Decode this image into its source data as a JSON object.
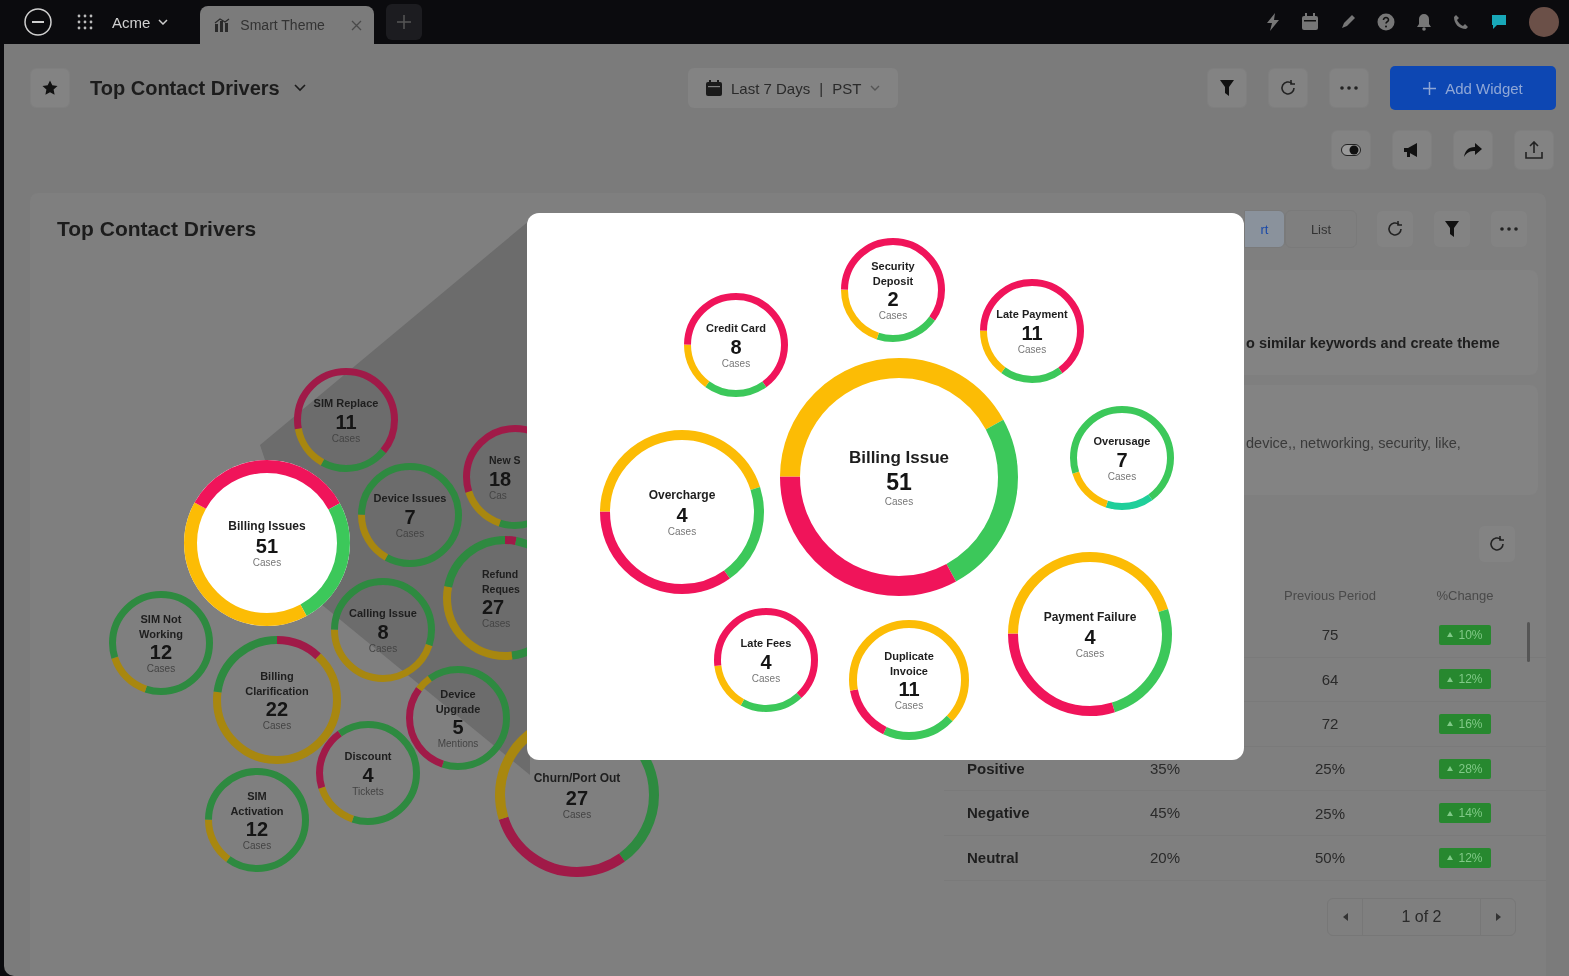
{
  "topbar": {
    "workspace": "Acme",
    "tabs": [
      {
        "label": "Smart Theme",
        "selected": true
      }
    ]
  },
  "header": {
    "title": "Top Contact Drivers",
    "date_range": "Last 7 Days",
    "separator": "|",
    "timezone": "PST",
    "add_button": "Add Widget"
  },
  "widget": {
    "title": "Top Contact Drivers",
    "view_tabs": [
      {
        "label": "rt",
        "selected": true
      },
      {
        "label": "List",
        "selected": false
      }
    ],
    "bubbles": [
      {
        "label": "SIM Replace",
        "count": "11",
        "unit": "Cases",
        "selected": false
      },
      {
        "label": "New S",
        "count": "18",
        "unit": "Cas",
        "selected": false
      },
      {
        "label": "Billing Issues",
        "count": "51",
        "unit": "Cases",
        "selected": true
      },
      {
        "label": "Device Issues",
        "count": "7",
        "unit": "Cases",
        "selected": false
      },
      {
        "label": "Refund Reques",
        "count": "27",
        "unit": "Cases",
        "selected": false
      },
      {
        "label": "SIM Not Working",
        "count": "12",
        "unit": "Cases",
        "selected": false
      },
      {
        "label": "Calling Issue",
        "count": "8",
        "unit": "Cases",
        "selected": false
      },
      {
        "label": "Billing Clarification",
        "count": "22",
        "unit": "Cases",
        "selected": false
      },
      {
        "label": "Device Upgrade",
        "count": "5",
        "unit": "Mentions",
        "selected": false
      },
      {
        "label": "Discount",
        "count": "4",
        "unit": "Tickets",
        "selected": false
      },
      {
        "label": "SIM Activation",
        "count": "12",
        "unit": "Cases",
        "selected": false
      },
      {
        "label": "Churn/Port Out",
        "count": "27",
        "unit": "Cases",
        "selected": false
      }
    ],
    "theme_note": "o similar keywords and create theme",
    "keywords": "device,, networking, security, like,",
    "table": {
      "columns": [
        "Previous Period",
        "%Change"
      ],
      "rows": [
        {
          "previous": "75",
          "change": "10%"
        },
        {
          "previous": "64",
          "change": "12%"
        },
        {
          "previous": "72",
          "change": "16%"
        },
        {
          "label": "Positive",
          "current": "35%",
          "previous": "25%",
          "change": "28%"
        },
        {
          "label": "Negative",
          "current": "45%",
          "previous": "25%",
          "change": "14%"
        },
        {
          "label": "Neutral",
          "current": "20%",
          "previous": "50%",
          "change": "12%"
        }
      ]
    },
    "pagination": "1 of 2"
  },
  "modal": {
    "bubbles": [
      {
        "label": "Security Deposit",
        "count": "2",
        "unit": "Cases"
      },
      {
        "label": "Credit Card",
        "count": "8",
        "unit": "Cases"
      },
      {
        "label": "Late Payment",
        "count": "11",
        "unit": "Cases"
      },
      {
        "label": "Billing Issue",
        "count": "51",
        "unit": "Cases"
      },
      {
        "label": "Overusage",
        "count": "7",
        "unit": "Cases"
      },
      {
        "label": "Overcharge",
        "count": "4",
        "unit": "Cases"
      },
      {
        "label": "Payment Failure",
        "count": "4",
        "unit": "Cases"
      },
      {
        "label": "Late Fees",
        "count": "4",
        "unit": "Cases"
      },
      {
        "label": "Duplicate Invoice",
        "count": "11",
        "unit": "Cases"
      }
    ]
  }
}
